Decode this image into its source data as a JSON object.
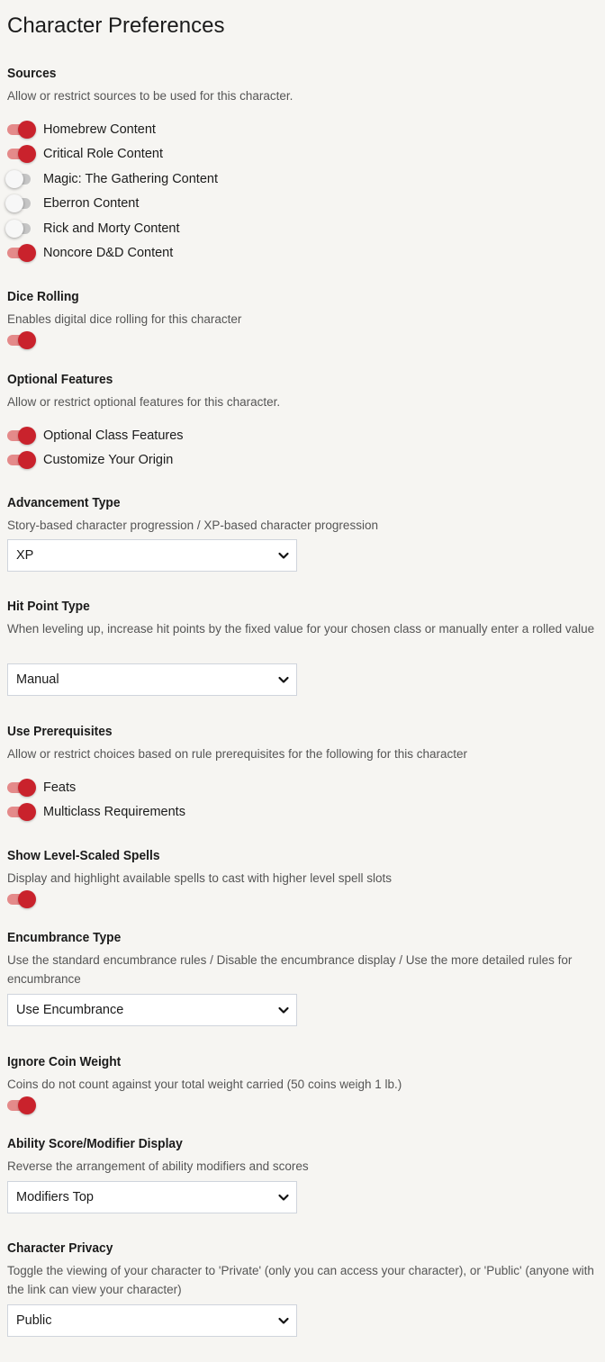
{
  "page_title": "Character Preferences",
  "sources": {
    "title": "Sources",
    "description": "Allow or restrict sources to be used for this character.",
    "toggles": [
      {
        "label": "Homebrew Content",
        "on": true
      },
      {
        "label": "Critical Role Content",
        "on": true
      },
      {
        "label": "Magic: The Gathering Content",
        "on": false
      },
      {
        "label": "Eberron Content",
        "on": false
      },
      {
        "label": "Rick and Morty Content",
        "on": false
      },
      {
        "label": "Noncore D&D Content",
        "on": true
      }
    ]
  },
  "dice_rolling": {
    "title": "Dice Rolling",
    "description": "Enables digital dice rolling for this character",
    "on": true
  },
  "optional_features": {
    "title": "Optional Features",
    "description": "Allow or restrict optional features for this character.",
    "toggles": [
      {
        "label": "Optional Class Features",
        "on": true
      },
      {
        "label": "Customize Your Origin",
        "on": true
      }
    ]
  },
  "advancement_type": {
    "title": "Advancement Type",
    "description": "Story-based character progression / XP-based character progression",
    "selected": "XP"
  },
  "hit_point_type": {
    "title": "Hit Point Type",
    "description": "When leveling up, increase hit points by the fixed value for your chosen class or manually enter a rolled value",
    "selected": "Manual"
  },
  "use_prerequisites": {
    "title": "Use Prerequisites",
    "description": "Allow or restrict choices based on rule prerequisites for the following for this character",
    "toggles": [
      {
        "label": "Feats",
        "on": true
      },
      {
        "label": "Multiclass Requirements",
        "on": true
      }
    ]
  },
  "level_scaled_spells": {
    "title": "Show Level-Scaled Spells",
    "description": "Display and highlight available spells to cast with higher level spell slots",
    "on": true
  },
  "encumbrance_type": {
    "title": "Encumbrance Type",
    "description": "Use the standard encumbrance rules / Disable the encumbrance display / Use the more detailed rules for encumbrance",
    "selected": "Use Encumbrance"
  },
  "ignore_coin_weight": {
    "title": "Ignore Coin Weight",
    "description": "Coins do not count against your total weight carried (50 coins weigh 1 lb.)",
    "on": true
  },
  "ability_display": {
    "title": "Ability Score/Modifier Display",
    "description": "Reverse the arrangement of ability modifiers and scores",
    "selected": "Modifiers Top"
  },
  "character_privacy": {
    "title": "Character Privacy",
    "description": "Toggle the viewing of your character to 'Private' (only you can access your character), or 'Public' (anyone with the link can view your character)",
    "selected": "Public"
  },
  "icons": {
    "toggle": "toggle-switch",
    "dropdown": "chevron-down-icon"
  },
  "colors": {
    "accent": "#c9222c",
    "accent_track": "#e48a8a",
    "off_track": "#c5c5c5",
    "background": "#f6f5f2"
  }
}
